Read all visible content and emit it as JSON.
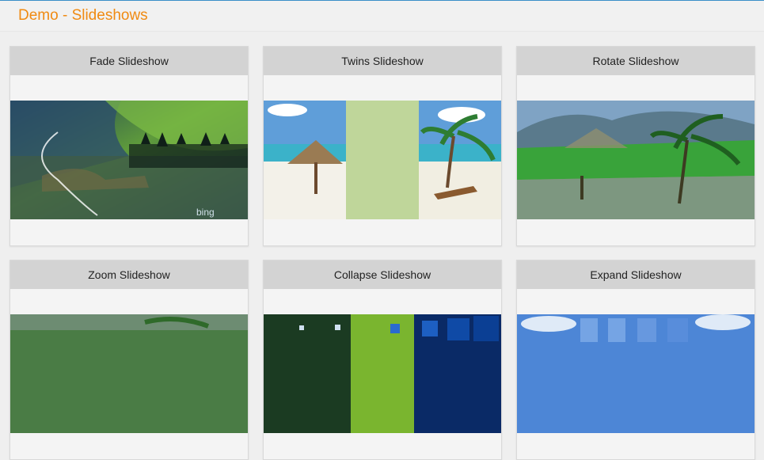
{
  "header": {
    "title": "Demo - Slideshows"
  },
  "cards": [
    {
      "title": "Fade Slideshow",
      "watermark": "bing"
    },
    {
      "title": "Twins Slideshow"
    },
    {
      "title": "Rotate Slideshow"
    },
    {
      "title": "Zoom Slideshow"
    },
    {
      "title": "Collapse Slideshow"
    },
    {
      "title": "Expand Slideshow"
    }
  ],
  "colors": {
    "title": "#f08a12",
    "card_header": "#d3d3d3",
    "page_background": "#efefef"
  }
}
